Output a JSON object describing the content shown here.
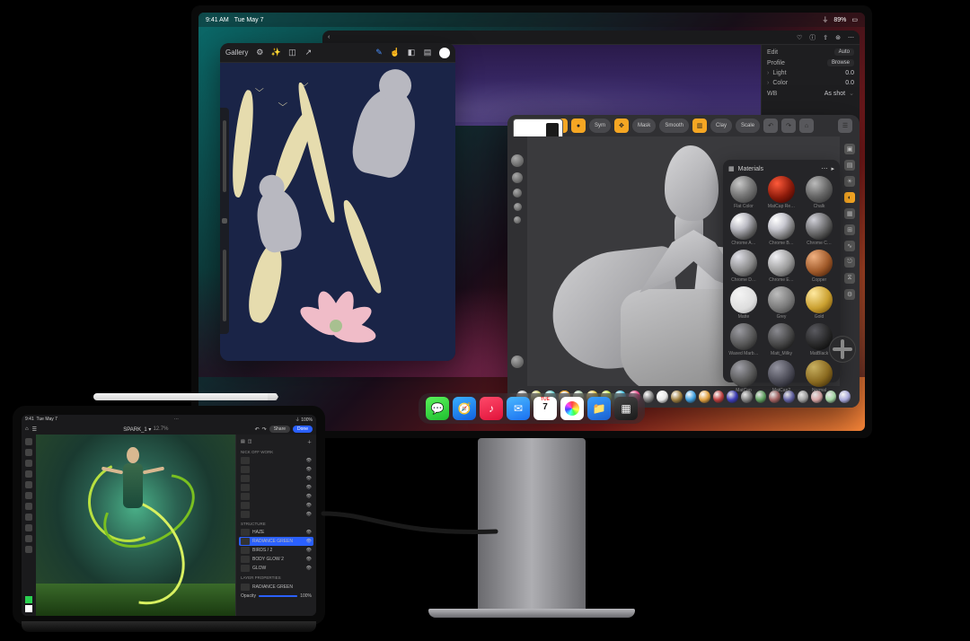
{
  "monitor_menubar": {
    "time": "9:41 AM",
    "date": "Tue May 7",
    "battery": "89%"
  },
  "photo_editor": {
    "edit": "Edit",
    "auto": "Auto",
    "profile": "Profile",
    "browse": "Browse",
    "light": "Light",
    "color": "Color",
    "light_val": "0.0",
    "wb_label": "WB",
    "wb_value": "As shot"
  },
  "procreate": {
    "gallery": "Gallery"
  },
  "sculpt": {
    "top_pills": [
      "Sym",
      "Mask",
      "Smooth",
      "Clay",
      "Scale"
    ],
    "materials_title": "Materials",
    "materials": [
      {
        "l": "Flat Color"
      },
      {
        "l": "MatCap Re…"
      },
      {
        "l": "Chalk"
      },
      {
        "l": "Chrome A…"
      },
      {
        "l": "Chrome B…"
      },
      {
        "l": "Chrome C…"
      },
      {
        "l": "Chrome D…"
      },
      {
        "l": "Chrome E…"
      },
      {
        "l": "Copper"
      },
      {
        "l": "Matte"
      },
      {
        "l": "Grey"
      },
      {
        "l": "Gold"
      },
      {
        "l": "Waxed Marb…"
      },
      {
        "l": "Matt_Milky"
      },
      {
        "l": "MatBlack"
      },
      {
        "l": "MatCap"
      },
      {
        "l": "MatCap2"
      },
      {
        "l": "Normal"
      }
    ],
    "mat_colors": [
      "radial-gradient(circle at 34% 28%,#c8c8c8,#7a7a7a 45%,#2a2a2a)",
      "radial-gradient(circle at 34% 28%,#ff5a3a,#8a1a0a 55%,#200)",
      "radial-gradient(circle at 34% 28%,#bbb,#666 50%,#222)",
      "radial-gradient(circle at 30% 26%,#fff,#bcbcc4 35%,#555 70%,#111)",
      "radial-gradient(circle at 30% 26%,#fff,#c8c8d0 35%,#666 70%,#111)",
      "radial-gradient(circle at 30% 26%,#d0d0d8,#555 60%,#000)",
      "radial-gradient(circle at 30% 26%,#e0e0e8,#888 55%,#111)",
      "radial-gradient(circle at 30% 26%,#f0f0f4,#999 55%,#222)",
      "radial-gradient(circle at 30% 26%,#f0b080,#a05a2a 55%,#301000)",
      "radial-gradient(circle at 34% 28%,#f4f4f4,#ddd 60%,#999)",
      "radial-gradient(circle at 34% 28%,#bdbdbd,#7a7a7a 55%,#333)",
      "radial-gradient(circle at 30% 26%,#ffe9a0,#caa030 55%,#5a3a00)",
      "radial-gradient(circle at 34% 28%,#9a9aa0,#555 55%,#111)",
      "radial-gradient(circle at 34% 28%,#8a8a90,#444 55%,#000)",
      "radial-gradient(circle at 34% 28%,#5a5a60,#222 60%,#000)",
      "radial-gradient(circle at 34% 28%,#a0a0a8,#555 55%,#111)",
      "radial-gradient(circle at 34% 28%,#9494a0,#4a4a55 55%,#0a0a10)",
      "radial-gradient(circle at 30% 26%,#c8b060,#8a6a20 55%,#2a1a00)"
    ]
  },
  "dock": {
    "apps": [
      {
        "name": "messages-app",
        "bg": "linear-gradient(160deg,#5af25a,#1fbf30)",
        "glyph": "💬"
      },
      {
        "name": "safari-app",
        "bg": "linear-gradient(160deg,#3ab0ff,#1060e0)",
        "glyph": "🧭"
      },
      {
        "name": "music-app",
        "bg": "linear-gradient(160deg,#ff4a6a,#e0123a)",
        "glyph": "♪"
      },
      {
        "name": "mail-app",
        "bg": "linear-gradient(160deg,#4ab8ff,#1a70f0)",
        "glyph": "✉"
      },
      {
        "name": "calendar-app",
        "type": "cal"
      },
      {
        "name": "photos-app",
        "bg": "#fff",
        "glyph": "❀"
      },
      {
        "name": "files-app",
        "bg": "linear-gradient(160deg,#3aa0ff,#1a60d0)",
        "glyph": "📁"
      },
      {
        "name": "launchpad-app",
        "bg": "linear-gradient(160deg,#444,#1a1a1a)",
        "glyph": "▦"
      }
    ],
    "cal_label": "TUE",
    "cal_day": "7"
  },
  "ipad": {
    "menubar": {
      "time": "9:41",
      "date": "Tue May 7",
      "battery": "100%"
    },
    "title": "SPARK_1 ▾",
    "zoom": "12.7%",
    "done": "Done",
    "share": "Share",
    "top_sections": [
      "NICK OFF WORK"
    ],
    "layers": [
      {
        "s": "head",
        "t": ""
      },
      {
        "s": "face",
        "t": ""
      },
      {
        "s": "body",
        "t": ""
      },
      {
        "s": "fx1",
        "t": ""
      },
      {
        "s": "fx2",
        "t": ""
      },
      {
        "s": "fx3",
        "t": ""
      },
      {
        "s": "fx4",
        "t": ""
      }
    ],
    "structure_label": "STRUCTURE",
    "structure": [
      {
        "t": "HAZE"
      },
      {
        "t": "RADIANCE GREEN",
        "sel": true
      },
      {
        "t": "BIRDS / 2"
      },
      {
        "t": "BODY GLOW 2"
      },
      {
        "t": "GLOW"
      }
    ],
    "props_title": "Layer properties",
    "normal": "RADIANCE GREEN",
    "opacity_label": "Opacity",
    "opacity": "100%",
    "swatches": [
      "#2ad050",
      "#ffffff"
    ]
  }
}
